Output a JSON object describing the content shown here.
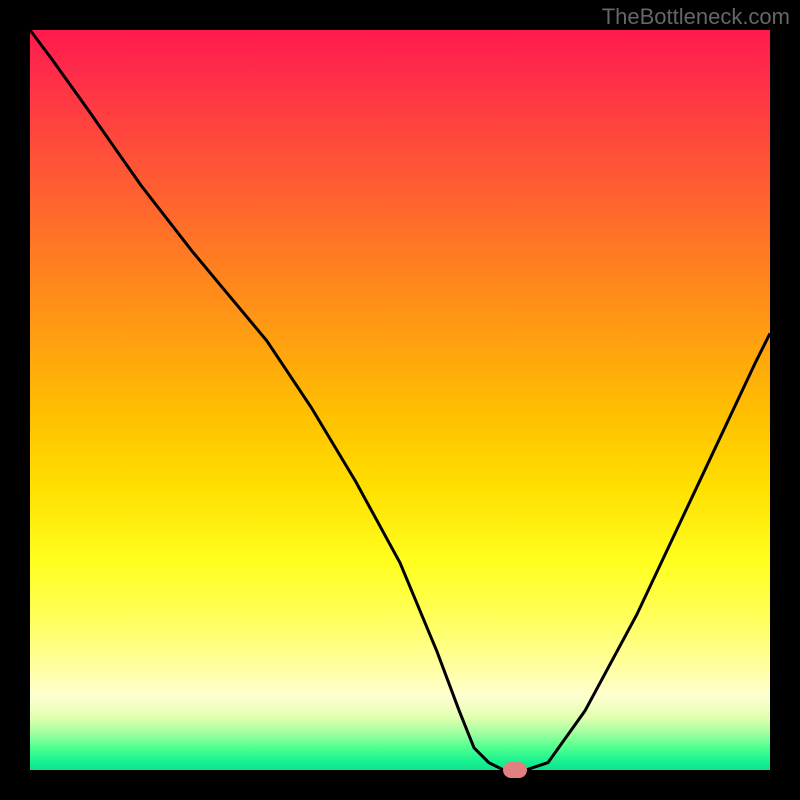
{
  "meta": {
    "watermark": "TheBottleneck.com"
  },
  "chart_data": {
    "type": "line",
    "title": "",
    "xlabel": "",
    "ylabel": "",
    "xlim": [
      0,
      100
    ],
    "ylim": [
      0,
      100
    ],
    "grid": false,
    "background_gradient": {
      "top_color": "#ff1a4d",
      "middle_color": "#ffe000",
      "bottom_color": "#13e08f"
    },
    "series": [
      {
        "name": "bottleneck-curve",
        "color": "#000000",
        "x": [
          0,
          3,
          8,
          15,
          22,
          27,
          32,
          38,
          44,
          50,
          55,
          58,
          60,
          62,
          64,
          67,
          70,
          75,
          82,
          90,
          98,
          100
        ],
        "values": [
          100,
          96,
          89,
          79,
          70,
          64,
          58,
          49,
          39,
          28,
          16,
          8,
          3,
          1,
          0,
          0,
          1,
          8,
          21,
          38,
          55,
          59
        ]
      }
    ],
    "marker": {
      "name": "optimal-point",
      "x": 65.5,
      "y": 0,
      "color": "#e08080"
    }
  }
}
